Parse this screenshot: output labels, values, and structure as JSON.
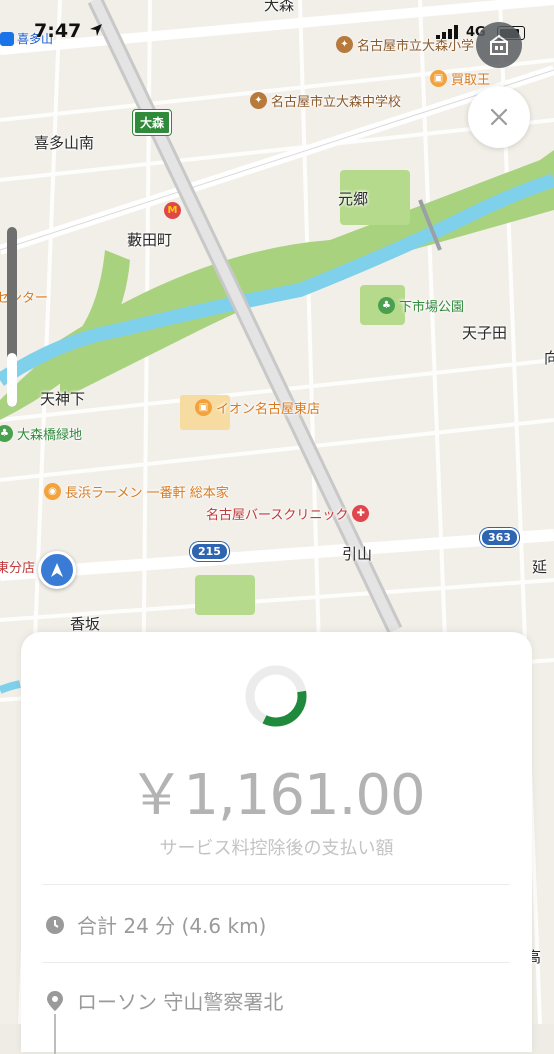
{
  "status_bar": {
    "time": "7:47",
    "network": "4G",
    "back_app": "喜多山"
  },
  "map": {
    "labels": [
      {
        "id": "omori-top",
        "text": "大森"
      },
      {
        "id": "kitayamaminami",
        "text": "喜多山南"
      },
      {
        "id": "yabutacho",
        "text": "藪田町"
      },
      {
        "id": "motogo",
        "text": "元郷"
      },
      {
        "id": "amagoda",
        "text": "天子田"
      },
      {
        "id": "tenjinshita",
        "text": "天神下"
      },
      {
        "id": "hikiyama",
        "text": "引山"
      },
      {
        "id": "kousaka",
        "text": "香坂"
      },
      {
        "id": "nobu",
        "text": "延"
      },
      {
        "id": "edge-mu",
        "text": "向"
      },
      {
        "id": "edge-ko",
        "text": "高"
      }
    ],
    "pois": [
      {
        "id": "omori-elementary",
        "text": "名古屋市立大森小学",
        "color": "brown"
      },
      {
        "id": "omori-junior-high",
        "text": "名古屋市立大森中学校",
        "color": "brown"
      },
      {
        "id": "kaitori",
        "text": "買取王",
        "color": "orange"
      },
      {
        "id": "shimoichiba-park",
        "text": "下市場公園",
        "color": "green"
      },
      {
        "id": "aeon",
        "text": "イオン名古屋東店",
        "color": "orange"
      },
      {
        "id": "omori-green",
        "text": "大森橋緑地",
        "color": "green"
      },
      {
        "id": "ramen",
        "text": "長浜ラーメン 一番軒 総本家",
        "color": "orange"
      },
      {
        "id": "clinic",
        "text": "名古屋バースクリニック",
        "color": "red"
      },
      {
        "id": "center",
        "text": "センター",
        "color": "orange"
      },
      {
        "id": "higashi-branch",
        "text": "東分店",
        "color": "red"
      }
    ],
    "exit_sign": "大森",
    "route_shields": [
      "215",
      "363"
    ]
  },
  "card": {
    "amount": "￥1,161.00",
    "subtitle": "サービス料控除後の支払い額",
    "duration": "合計 24 分 (4.6 km)",
    "location": "ローソン 守山警察署北"
  },
  "colors": {
    "progress": "#1f8a3c",
    "road": "#ffffff",
    "river": "#7fd0ea",
    "park": "#a9d27e"
  },
  "progress_fraction": 0.35,
  "slider_fraction": 0.3
}
